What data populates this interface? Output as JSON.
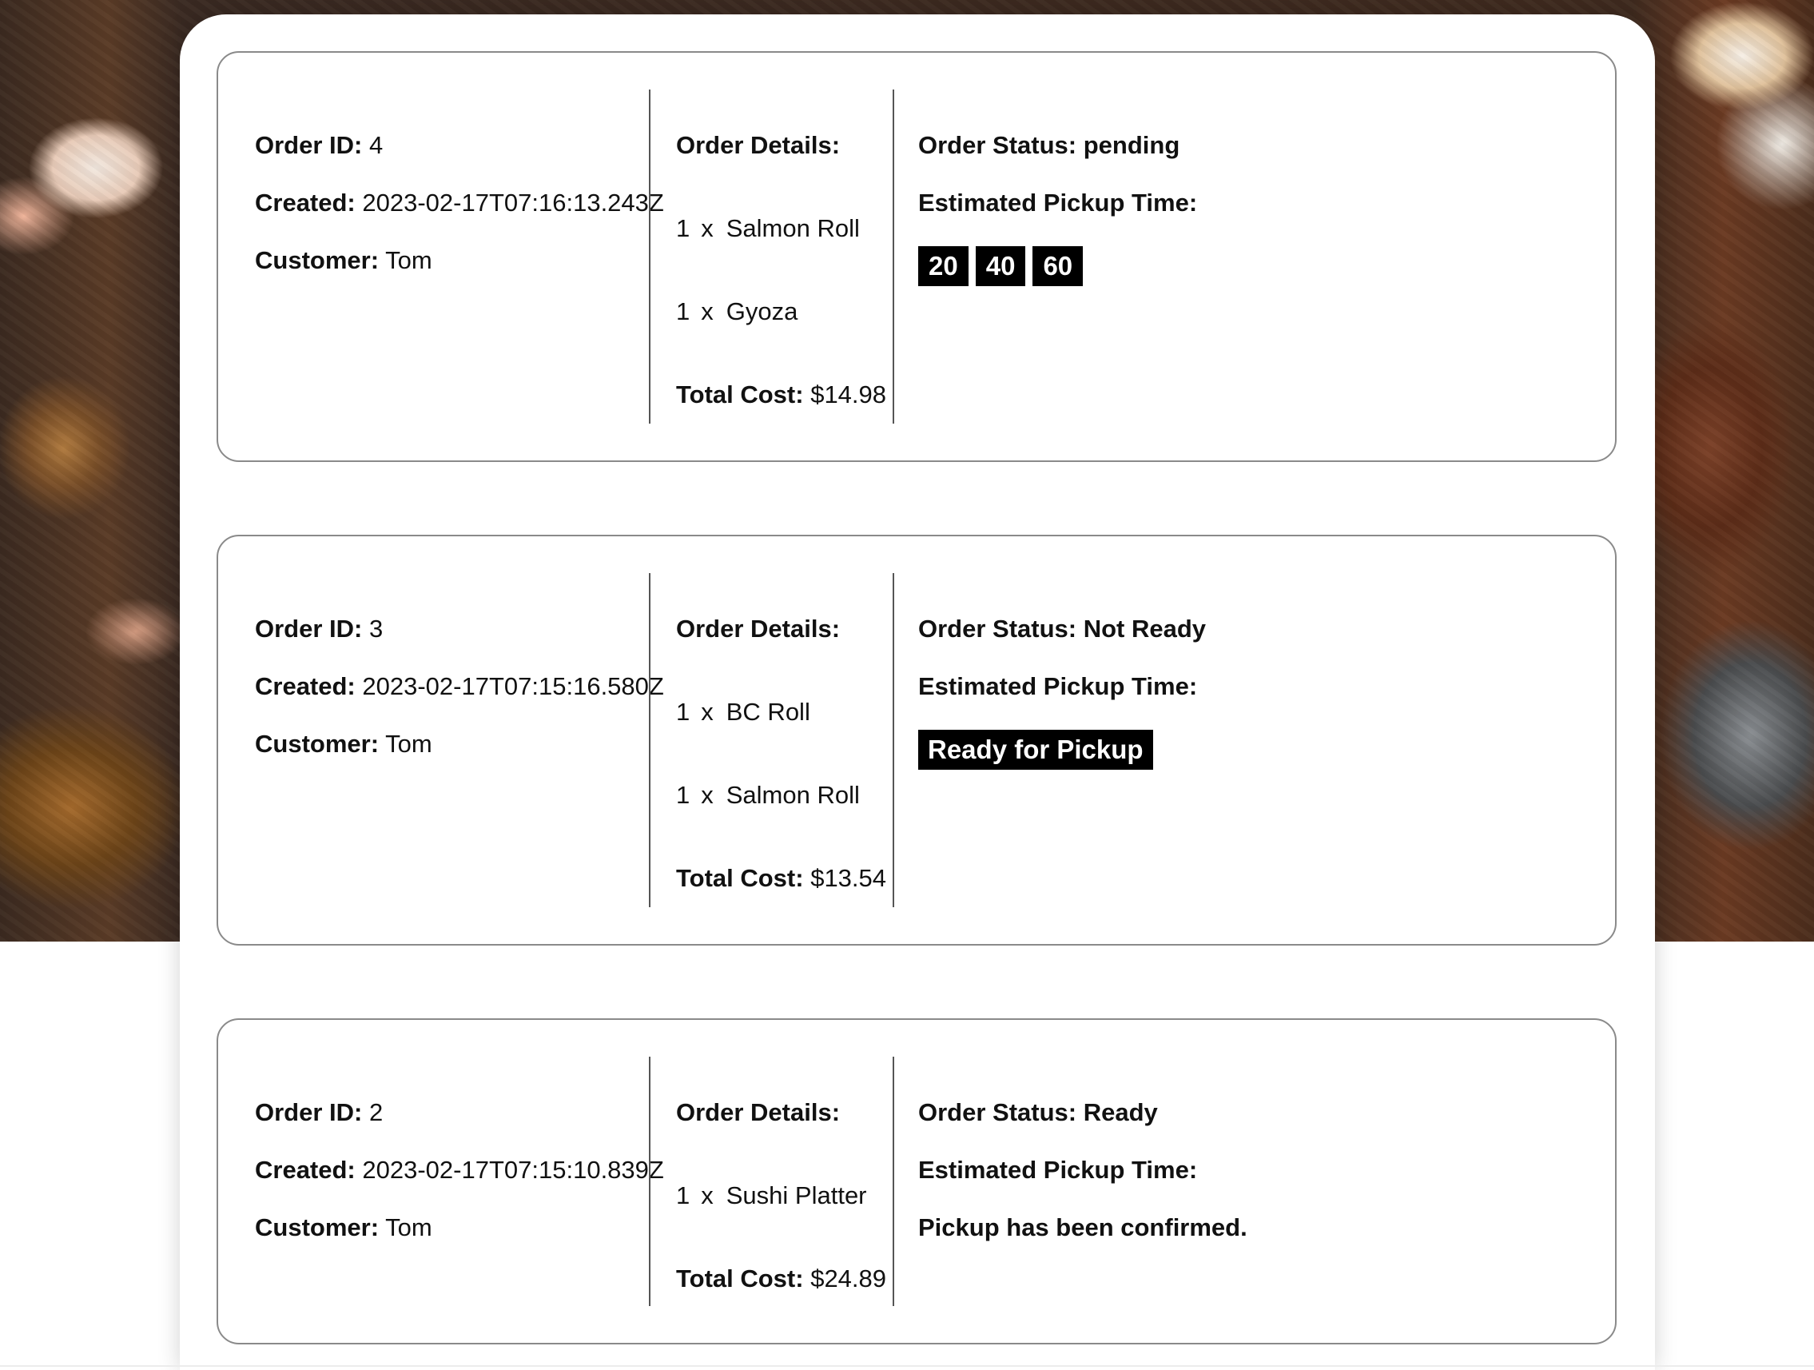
{
  "labels": {
    "order_id": "Order ID:",
    "created": "Created:",
    "customer": "Customer:",
    "order_details": "Order Details:",
    "total_cost": "Total Cost:",
    "order_status": "Order Status:",
    "estimated_pickup": "Estimated Pickup Time:",
    "item_separator": "x"
  },
  "orders": [
    {
      "id": "4",
      "created": "2023-02-17T07:16:13.243Z",
      "customer": "Tom",
      "items": [
        {
          "qty": "1",
          "name": "Salmon Roll"
        },
        {
          "qty": "1",
          "name": "Gyoza"
        }
      ],
      "total": "$14.98",
      "status": "pending",
      "time_options": [
        "20",
        "40",
        "60"
      ]
    },
    {
      "id": "3",
      "created": "2023-02-17T07:15:16.580Z",
      "customer": "Tom",
      "items": [
        {
          "qty": "1",
          "name": "BC Roll"
        },
        {
          "qty": "1",
          "name": "Salmon Roll"
        }
      ],
      "total": "$13.54",
      "status": "Not Ready",
      "action_label": "Ready for Pickup"
    },
    {
      "id": "2",
      "created": "2023-02-17T07:15:10.839Z",
      "customer": "Tom",
      "items": [
        {
          "qty": "1",
          "name": "Sushi Platter"
        }
      ],
      "total": "$24.89",
      "status": "Ready",
      "pickup_message": "Pickup has been confirmed."
    }
  ]
}
